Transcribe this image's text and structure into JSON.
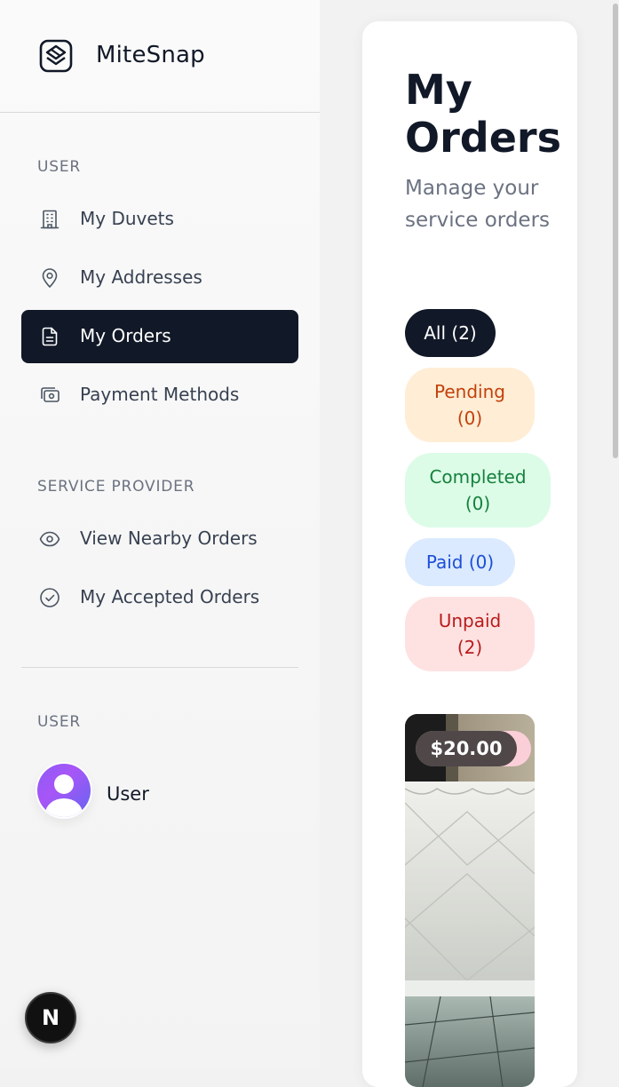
{
  "brand": {
    "name": "MiteSnap",
    "logo_icon": "layers-logo-icon"
  },
  "sidebar": {
    "user_section_label": "USER",
    "provider_section_label": "SERVICE PROVIDER",
    "account_section_label": "USER",
    "user_items": [
      {
        "label": "My Duvets",
        "icon": "building-icon",
        "active": false
      },
      {
        "label": "My Addresses",
        "icon": "map-pin-icon",
        "active": false
      },
      {
        "label": "My Orders",
        "icon": "file-text-icon",
        "active": true
      },
      {
        "label": "Payment Methods",
        "icon": "wallet-icon",
        "active": false
      }
    ],
    "provider_items": [
      {
        "label": "View Nearby Orders",
        "icon": "eye-icon",
        "active": false
      },
      {
        "label": "My Accepted Orders",
        "icon": "check-circle-icon",
        "active": false
      }
    ],
    "user": {
      "name": "User",
      "avatar_icon": "user-avatar-icon"
    },
    "dev_badge_letter": "N"
  },
  "main": {
    "title": "My Orders",
    "subtitle": "Manage your service orders",
    "filters": [
      {
        "label": "All (2)",
        "line1": "All (2)",
        "line2": "",
        "selected": true
      },
      {
        "label": "Pending (0)",
        "line1": "Pending",
        "line2": "(0)",
        "selected": false
      },
      {
        "label": "Completed (0)",
        "line1": "Completed",
        "line2": "(0)",
        "selected": false
      },
      {
        "label": "Paid (0)",
        "line1": "Paid (0)",
        "line2": "",
        "selected": false
      },
      {
        "label": "Unpaid (2)",
        "line1": "Unpaid",
        "line2": "(2)",
        "selected": false
      }
    ],
    "orders": [
      {
        "price": "$20.00"
      }
    ]
  },
  "colors": {
    "sidebar_active_bg": "#111827",
    "pending": "#c2410c",
    "completed": "#15803d",
    "paid": "#1d4ed8",
    "unpaid": "#b91c1c"
  }
}
